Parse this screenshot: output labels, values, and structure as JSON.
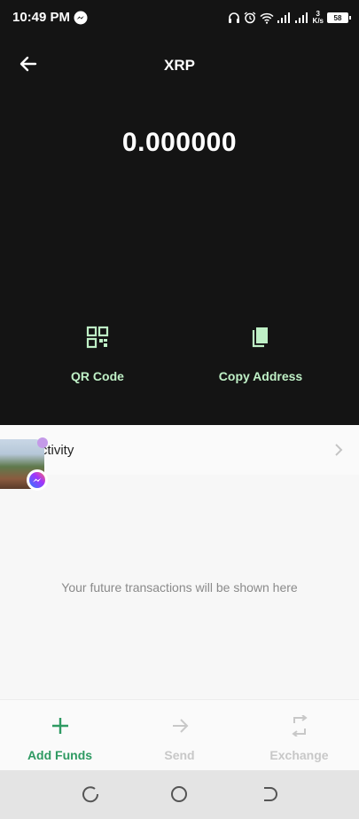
{
  "status_bar": {
    "time": "10:49 PM",
    "net_speed_value": "3",
    "net_speed_unit": "K/s",
    "battery": "58"
  },
  "header": {
    "title": "XRP",
    "balance": "0.000000"
  },
  "actions": {
    "qr_label": "QR Code",
    "copy_label": "Copy Address"
  },
  "activity": {
    "title": "nt Activity",
    "empty_message": "Your future transactions will be shown here"
  },
  "bottom_nav": {
    "add_funds": "Add Funds",
    "send": "Send",
    "exchange": "Exchange"
  },
  "colors": {
    "background_dark": "#141414",
    "accent_green": "#2e9a62",
    "action_label": "#bff0c6",
    "disabled": "#c8c8c8"
  },
  "icons": [
    "messenger-icon",
    "headphones-icon",
    "alarm-icon",
    "wifi-icon",
    "signal-icon",
    "battery-icon",
    "back-arrow-icon",
    "qr-code-icon",
    "copy-icon",
    "chevron-right-icon",
    "plus-icon",
    "arrow-right-icon",
    "exchange-icon",
    "recents-icon",
    "home-icon",
    "back-icon"
  ]
}
